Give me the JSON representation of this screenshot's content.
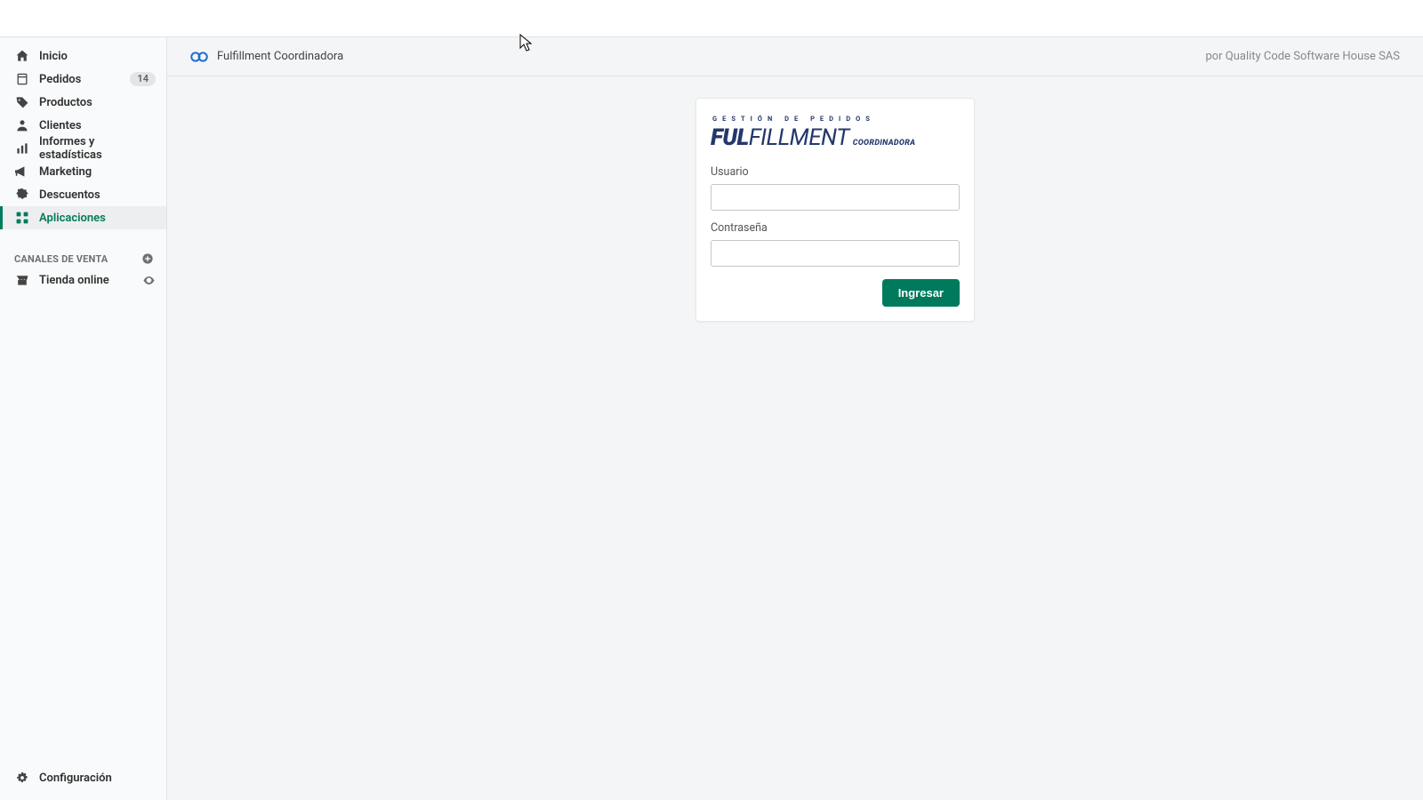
{
  "sidebar": {
    "items": [
      {
        "label": "Inicio"
      },
      {
        "label": "Pedidos",
        "badge": "14"
      },
      {
        "label": "Productos"
      },
      {
        "label": "Clientes"
      },
      {
        "label": "Informes y estadísticas"
      },
      {
        "label": "Marketing"
      },
      {
        "label": "Descuentos"
      },
      {
        "label": "Aplicaciones"
      }
    ],
    "channels_header": "CANALES DE VENTA",
    "channels": [
      {
        "label": "Tienda online"
      }
    ],
    "settings_label": "Configuración"
  },
  "app_header": {
    "title": "Fulfillment Coordinadora",
    "author": "por Quality Code Software House SAS"
  },
  "panel": {
    "logo_kicker": "GESTIÓN DE PEDIDOS",
    "logo_bold": "FUL",
    "logo_light": "FILLMENT",
    "logo_brand": "COORDINADORA",
    "user_label": "Usuario",
    "password_label": "Contraseña",
    "submit_label": "Ingresar",
    "user_value": "",
    "password_value": ""
  }
}
